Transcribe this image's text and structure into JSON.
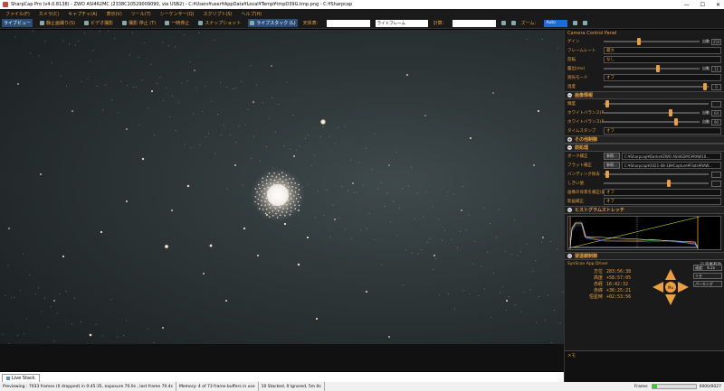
{
  "window": {
    "title": "SharpCap Pro (v4.0.8138) - ZWO ASI462MC (2338C10529009090, via USB2) - C:¥Users¥user¥AppData¥Local¥Temp¥tmpD39G.tmp.png - C:¥Sharpcap",
    "minimize": "—",
    "maximize": "☐",
    "close": "✕"
  },
  "menu": [
    "ファイル(F)",
    "カメラ(C)",
    "キャプチャ(A)",
    "表示(V)",
    "ツール(T)",
    "シーケンサー(Q)",
    "スクリプト(S)",
    "ヘルプ(H)"
  ],
  "toolbar": {
    "live_view": "ライブビュー",
    "snapshot": "静止画撮り(S)",
    "video_start": "ビデオ撮影",
    "video_stop": "撮影 停止 (T)",
    "pause": "一時停止",
    "snapshot2": "スナップショット",
    "live_stack": "ライブスタック (L)",
    "antenna_label": "天体表：",
    "frame_label": "ライトフレーム",
    "reticle_label": "計算：",
    "zoom_label": "ズーム：",
    "zoom_value": "Auto"
  },
  "panel": {
    "title": "Camera Control Panel",
    "camera_rows": [
      {
        "label": "ゲイン",
        "knob": 0.35,
        "auto": "自動",
        "value": "350"
      },
      {
        "label": "フレームレート",
        "dropdown": "最大"
      },
      {
        "label": "反転",
        "dropdown": "なし"
      },
      {
        "label": "露出(ms)",
        "knob": 0.55,
        "auto": "自動",
        "value": "11"
      },
      {
        "label": "測光モード",
        "dropdown": "オフ"
      },
      {
        "label": "温度",
        "knob": 0.95,
        "value": "0"
      }
    ],
    "image_section": "画像情報",
    "image_rows": [
      {
        "label": "輝度",
        "knob": 0.02,
        "value": ""
      },
      {
        "label": "ホワイトバランス(R)",
        "knob": 0.68,
        "auto": "自動",
        "value": "64"
      },
      {
        "label": "ホワイトバランス(B)",
        "knob": 0.74,
        "auto": "自動",
        "value": "90"
      },
      {
        "label": "タイムスタンプ",
        "dropdown": "オフ"
      }
    ],
    "other_section": "その他制御",
    "preprocess_section": "前処理",
    "preprocess_rows": [
      {
        "label": "ダーク補正",
        "btn": "参照...",
        "path": "C:¥Sharpcap¥Darks¥ZWO ASI462MC¥RAW10..."
      },
      {
        "label": "フラット補正",
        "btn": "参照...",
        "path": "C:¥Sharpcap¥2021-08-18¥Capture¥Flats¥RAW..."
      },
      {
        "label": "バンディング除去",
        "knob": 0.02,
        "value": ""
      },
      {
        "label": "しきい値",
        "knob": 0.6,
        "value": ""
      },
      {
        "label": "画像の背景を補正(最適化)",
        "dropdown": "オフ"
      },
      {
        "label": "影画補正",
        "dropdown": "オフ"
      }
    ],
    "histogram_section": "ヒストグラムストレッチ",
    "telescope_section": "望遠鏡制御",
    "telescope": {
      "driver": "SynScan App Driver",
      "tracking": "追尾有効",
      "speed_label": "速度：",
      "speed_value": "8.2x",
      "parking": "パーキング",
      "coords": [
        {
          "k": "方位",
          "v": "283:56:38"
        },
        {
          "k": "高度",
          "v": "+58:57:05"
        },
        {
          "k": "赤経",
          "v": "16:42:32"
        },
        {
          "k": "赤緯",
          "v": "+36:25:21"
        },
        {
          "k": "恒星時",
          "v": "+02:53:56"
        }
      ],
      "center": "Mu",
      "side_btn": "リセ"
    },
    "notes_label": "メモ"
  },
  "tab": {
    "label": "Live Stack"
  },
  "status": {
    "previewing": "Previewing : 7033 frames (0 dropped) in 0:45:35, exposure 70.0s , last frame 70.4s",
    "memory": "Memory: 4 of 73 frame buffers in use",
    "stacked": "10 Stacked, 0 Ignored, 5m 0s",
    "frame_label": "Frame:",
    "frame_progress": 0.12,
    "frame_value": "0000/0027"
  },
  "colors": {
    "accent": "#e8a040",
    "panel_bg": "#1a1a1a",
    "active_tab": "#2a4d7a"
  }
}
